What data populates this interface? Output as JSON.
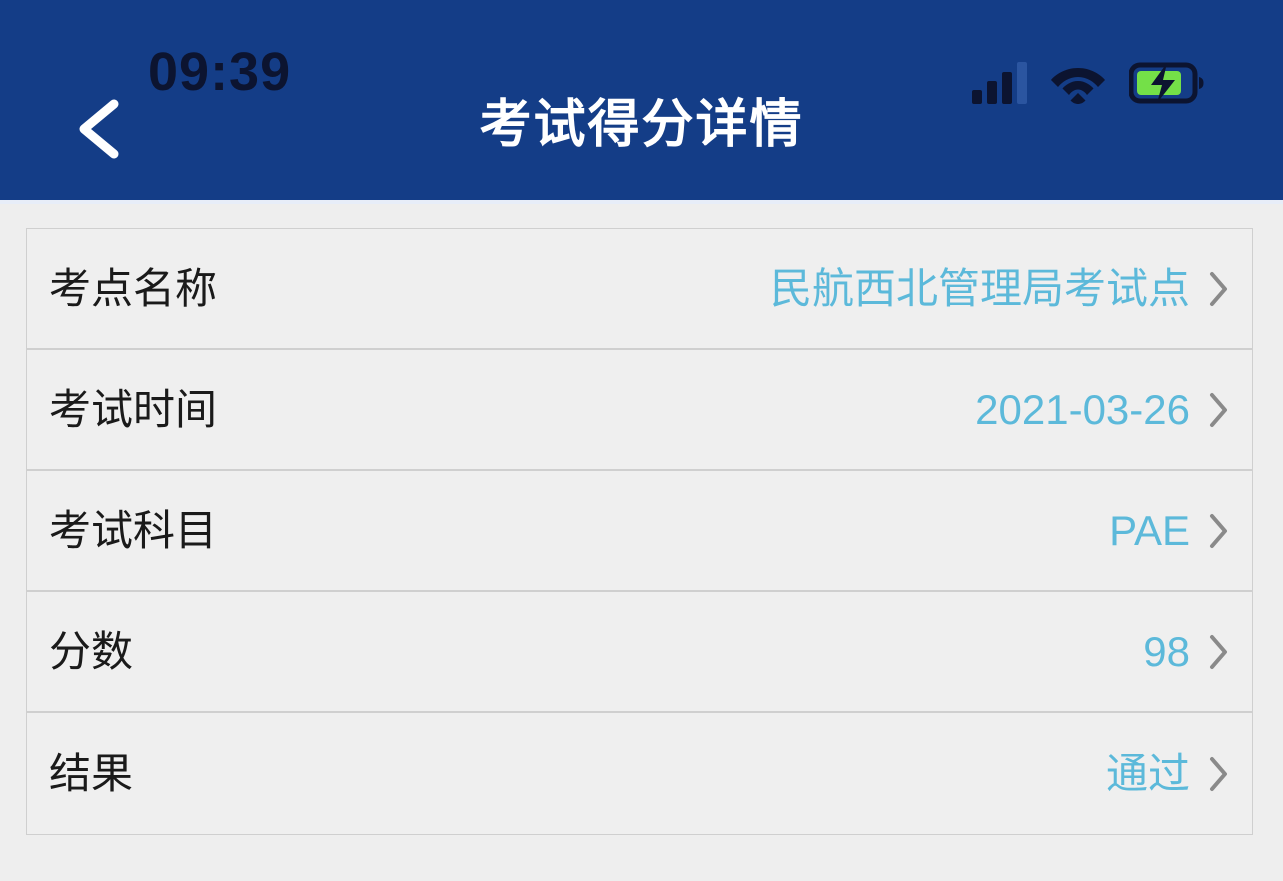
{
  "status_bar": {
    "time": "09:39",
    "signal_icon": "signal-bars-icon",
    "signal_bars_total": 4,
    "signal_bars_active": 3,
    "wifi_icon": "wifi-icon",
    "battery_icon": "battery-charging-icon",
    "battery_level_percent": 75,
    "battery_charging": true
  },
  "header": {
    "title": "考试得分详情",
    "back_icon": "chevron-left-icon",
    "background_color": "#143d87",
    "title_color": "#ffffff"
  },
  "colors": {
    "page_background": "#eeeeee",
    "card_background": "#efefef",
    "card_border": "#cfcfcf",
    "label_text": "#1a1a1a",
    "value_text": "#5cb9da",
    "chevron": "#8a8a8a",
    "status_icon_dark": "#0c1430",
    "battery_fill_green": "#74e048"
  },
  "detail_list": {
    "rows": [
      {
        "label": "考点名称",
        "value": "民航西北管理局考试点",
        "chevron_icon": "chevron-right-icon"
      },
      {
        "label": "考试时间",
        "value": "2021-03-26",
        "chevron_icon": "chevron-right-icon"
      },
      {
        "label": "考试科目",
        "value": "PAE",
        "chevron_icon": "chevron-right-icon"
      },
      {
        "label": "分数",
        "value": "98",
        "chevron_icon": "chevron-right-icon"
      },
      {
        "label": "结果",
        "value": "通过",
        "chevron_icon": "chevron-right-icon"
      }
    ]
  }
}
